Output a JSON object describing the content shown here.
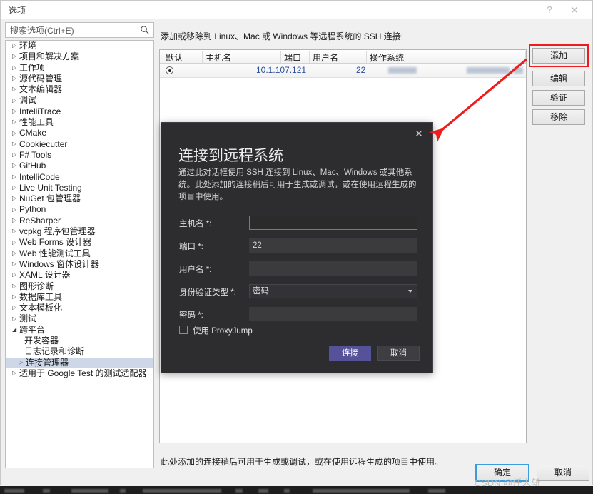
{
  "window": {
    "title": "选项",
    "help_icon": "question-mark-icon",
    "close_icon": "close-icon"
  },
  "search": {
    "placeholder": "搜索选项(Ctrl+E)",
    "value": "",
    "icon": "search-icon"
  },
  "tree": {
    "items": [
      {
        "label": "环境",
        "expandable": true,
        "expanded": false,
        "depth": 0,
        "selected": false
      },
      {
        "label": "项目和解决方案",
        "expandable": true,
        "expanded": false,
        "depth": 0,
        "selected": false
      },
      {
        "label": "工作项",
        "expandable": true,
        "expanded": false,
        "depth": 0,
        "selected": false
      },
      {
        "label": "源代码管理",
        "expandable": true,
        "expanded": false,
        "depth": 0,
        "selected": false
      },
      {
        "label": "文本编辑器",
        "expandable": true,
        "expanded": false,
        "depth": 0,
        "selected": false
      },
      {
        "label": "调试",
        "expandable": true,
        "expanded": false,
        "depth": 0,
        "selected": false
      },
      {
        "label": "IntelliTrace",
        "expandable": true,
        "expanded": false,
        "depth": 0,
        "selected": false
      },
      {
        "label": "性能工具",
        "expandable": true,
        "expanded": false,
        "depth": 0,
        "selected": false
      },
      {
        "label": "CMake",
        "expandable": true,
        "expanded": false,
        "depth": 0,
        "selected": false
      },
      {
        "label": "Cookiecutter",
        "expandable": true,
        "expanded": false,
        "depth": 0,
        "selected": false
      },
      {
        "label": "F# Tools",
        "expandable": true,
        "expanded": false,
        "depth": 0,
        "selected": false
      },
      {
        "label": "GitHub",
        "expandable": true,
        "expanded": false,
        "depth": 0,
        "selected": false
      },
      {
        "label": "IntelliCode",
        "expandable": true,
        "expanded": false,
        "depth": 0,
        "selected": false
      },
      {
        "label": "Live Unit Testing",
        "expandable": true,
        "expanded": false,
        "depth": 0,
        "selected": false
      },
      {
        "label": "NuGet 包管理器",
        "expandable": true,
        "expanded": false,
        "depth": 0,
        "selected": false
      },
      {
        "label": "Python",
        "expandable": true,
        "expanded": false,
        "depth": 0,
        "selected": false
      },
      {
        "label": "ReSharper",
        "expandable": true,
        "expanded": false,
        "depth": 0,
        "selected": false
      },
      {
        "label": "vcpkg 程序包管理器",
        "expandable": true,
        "expanded": false,
        "depth": 0,
        "selected": false
      },
      {
        "label": "Web Forms 设计器",
        "expandable": true,
        "expanded": false,
        "depth": 0,
        "selected": false
      },
      {
        "label": "Web 性能测试工具",
        "expandable": true,
        "expanded": false,
        "depth": 0,
        "selected": false
      },
      {
        "label": "Windows 窗体设计器",
        "expandable": true,
        "expanded": false,
        "depth": 0,
        "selected": false
      },
      {
        "label": "XAML 设计器",
        "expandable": true,
        "expanded": false,
        "depth": 0,
        "selected": false
      },
      {
        "label": "图形诊断",
        "expandable": true,
        "expanded": false,
        "depth": 0,
        "selected": false
      },
      {
        "label": "数据库工具",
        "expandable": true,
        "expanded": false,
        "depth": 0,
        "selected": false
      },
      {
        "label": "文本模板化",
        "expandable": true,
        "expanded": false,
        "depth": 0,
        "selected": false
      },
      {
        "label": "测试",
        "expandable": true,
        "expanded": false,
        "depth": 0,
        "selected": false
      },
      {
        "label": "跨平台",
        "expandable": true,
        "expanded": true,
        "depth": 0,
        "selected": false
      },
      {
        "label": "开发容器",
        "expandable": false,
        "expanded": false,
        "depth": 1,
        "selected": false
      },
      {
        "label": "日志记录和诊断",
        "expandable": false,
        "expanded": false,
        "depth": 1,
        "selected": false
      },
      {
        "label": "连接管理器",
        "expandable": true,
        "expanded": false,
        "depth": 1,
        "selected": true
      },
      {
        "label": "适用于 Google Test 的测试适配器",
        "expandable": true,
        "expanded": false,
        "depth": 0,
        "selected": false
      }
    ]
  },
  "content": {
    "description": "添加或移除到 Linux、Mac 或 Windows 等远程系统的 SSH 连接:",
    "bottom_note": "此处添加的连接稍后可用于生成或调试，或在使用远程生成的项目中使用。",
    "grid": {
      "columns": [
        "默认",
        "主机名",
        "端口",
        "用户名",
        "操作系统"
      ],
      "rows": [
        {
          "default": true,
          "host": "10.1.107.121",
          "port": "22",
          "username": "",
          "os": ""
        }
      ]
    },
    "side_buttons": [
      {
        "label": "添加",
        "highlighted": true
      },
      {
        "label": "编辑",
        "highlighted": false
      },
      {
        "label": "验证",
        "highlighted": false
      },
      {
        "label": "移除",
        "highlighted": false
      }
    ]
  },
  "footer": {
    "ok_label": "确定",
    "cancel_label": "取消"
  },
  "modal": {
    "close_icon": "close-icon",
    "title": "连接到远程系统",
    "intro": "通过此对话框使用 SSH 连接到 Linux、Mac、Windows 或其他系统。此处添加的连接稍后可用于生成或调试，或在使用远程生成的项目中使用。",
    "fields": [
      {
        "label": "主机名 *:",
        "value": "",
        "type": "text",
        "focused": true
      },
      {
        "label": "端口 *:",
        "value": "22",
        "type": "text",
        "focused": false
      },
      {
        "label": "用户名 *:",
        "value": "",
        "type": "text",
        "focused": false
      },
      {
        "label": "身份验证类型 *:",
        "value": "密码",
        "type": "select",
        "focused": false
      },
      {
        "label": "密码 *:",
        "value": "",
        "type": "password",
        "focused": false
      }
    ],
    "checkbox": {
      "label": "使用 ProxyJump",
      "checked": false
    },
    "connect_label": "连接",
    "cancel_label": "取消",
    "accent_color": "#56529a"
  },
  "annotation": {
    "arrow_color": "#ee1c1c",
    "highlight_color": "#ee1c1c"
  },
  "watermark": {
    "text": "CSDN @仟人斩"
  }
}
